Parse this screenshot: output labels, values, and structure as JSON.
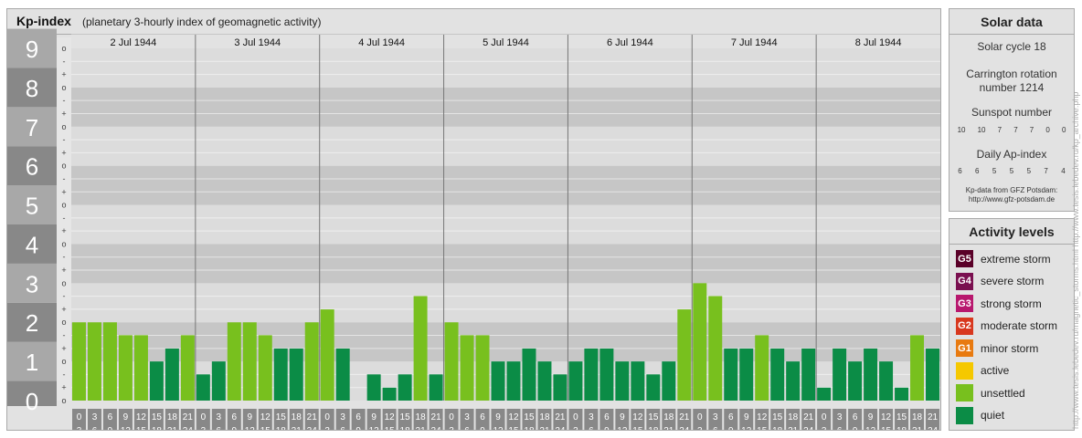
{
  "header": {
    "title": "Kp-index",
    "subtitle": "(planetary 3-hourly index of geomagnetic activity)"
  },
  "chart_data": {
    "type": "bar",
    "title": "Kp-index",
    "subtitle": "(planetary 3-hourly index of geomagnetic activity)",
    "days": [
      "2 Jul 1944",
      "3 Jul 1944",
      "4 Jul 1944",
      "5 Jul 1944",
      "6 Jul 1944",
      "7 Jul 1944",
      "8 Jul 1944"
    ],
    "interval_top": [
      "0",
      "3",
      "6",
      "9",
      "12",
      "15",
      "18",
      "21"
    ],
    "interval_bottom": [
      "3",
      "6",
      "9",
      "12",
      "15",
      "18",
      "21",
      "24"
    ],
    "y_major_labels": [
      "0",
      "1",
      "2",
      "3",
      "4",
      "5",
      "6",
      "7",
      "8",
      "9"
    ],
    "y_minor_labels": [
      "o",
      "+",
      "-",
      "o",
      "+",
      "-",
      "o",
      "+",
      "-",
      "o",
      "+",
      "-",
      "o",
      "+",
      "-",
      "o",
      "+",
      "-",
      "o",
      "+",
      "-",
      "o",
      "+",
      "-",
      "o",
      "+",
      "-",
      "o"
    ],
    "ylim": [
      0,
      9
    ],
    "values": [
      2.0,
      2.0,
      2.0,
      1.67,
      1.67,
      1.0,
      1.33,
      1.67,
      0.67,
      1.0,
      2.0,
      2.0,
      1.67,
      1.33,
      1.33,
      2.0,
      2.33,
      1.33,
      0.0,
      0.67,
      0.33,
      0.67,
      2.67,
      0.67,
      2.0,
      1.67,
      1.67,
      1.0,
      1.0,
      1.33,
      1.0,
      0.67,
      1.0,
      1.33,
      1.33,
      1.0,
      1.0,
      0.67,
      1.0,
      2.33,
      3.0,
      2.67,
      1.33,
      1.33,
      1.67,
      1.33,
      1.0,
      1.33,
      0.33,
      1.33,
      1.0,
      1.33,
      1.0,
      0.33,
      1.67,
      1.33
    ],
    "colors": {
      "quiet": "#0b8c46",
      "unsettled": "#78c01e",
      "active": "#f5c800",
      "band_dark": "#c6c6c6",
      "band_light": "#dcdcdc",
      "axis_dark": "#888888"
    }
  },
  "solar": {
    "title": "Solar data",
    "cycle": "Solar cycle 18",
    "carrington_1": "Carrington rotation",
    "carrington_2": "number 1214",
    "sunspot_title": "Sunspot number",
    "sunspot_values": [
      "10",
      "10",
      "7",
      "7",
      "7",
      "0",
      "0"
    ],
    "ap_title": "Daily Ap-index",
    "ap_values": [
      "6",
      "6",
      "5",
      "5",
      "5",
      "7",
      "4"
    ],
    "source_1": "Kp-data from GFZ Potsdam:",
    "source_2": "http://www.gfz-potsdam.de"
  },
  "activity": {
    "title": "Activity levels",
    "levels": [
      {
        "code": "G5",
        "label": "extreme storm",
        "color": "#5a0028"
      },
      {
        "code": "G4",
        "label": "severe storm",
        "color": "#7a1050"
      },
      {
        "code": "G3",
        "label": "strong storm",
        "color": "#b8186e"
      },
      {
        "code": "G2",
        "label": "moderate storm",
        "color": "#d8381e"
      },
      {
        "code": "G1",
        "label": "minor storm",
        "color": "#e87a10"
      },
      {
        "code": "",
        "label": "active",
        "color": "#f5c800"
      },
      {
        "code": "",
        "label": "unsettled",
        "color": "#78c01e"
      },
      {
        "code": "",
        "label": "quiet",
        "color": "#0b8c46"
      }
    ]
  },
  "watermark": "http://www.tesis.lebedev.ru/magnetic_storms.html  http://www.tesis.lebedev.ru/kp_archive.php"
}
